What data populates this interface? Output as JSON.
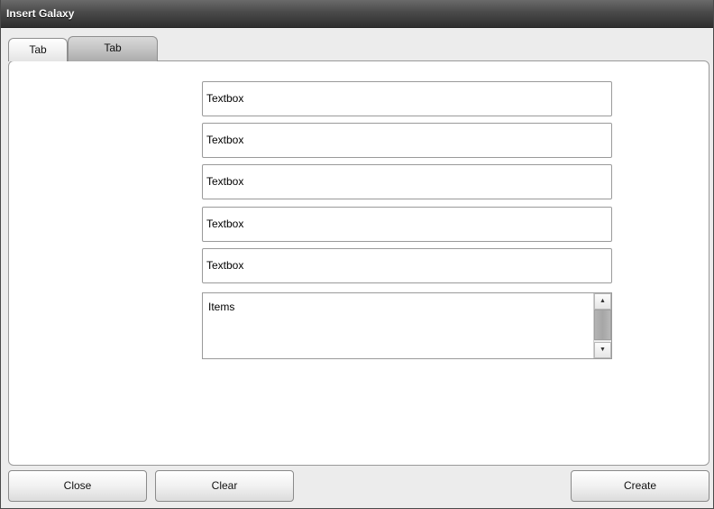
{
  "window": {
    "title": "Insert Galaxy"
  },
  "tabs": [
    {
      "label": "Tab"
    },
    {
      "label": "Tab"
    }
  ],
  "form": {
    "textboxes": [
      {
        "value": "Textbox"
      },
      {
        "value": "Textbox"
      },
      {
        "value": "Textbox"
      },
      {
        "value": "Textbox"
      },
      {
        "value": "Textbox"
      }
    ],
    "listbox": {
      "items": [
        "Items"
      ]
    }
  },
  "icons": {
    "scroll_up": "scroll-up-arrow-icon",
    "scroll_down": "scroll-down-arrow-icon"
  },
  "buttons": {
    "close_label": "Close",
    "clear_label": "Clear",
    "create_label": "Create"
  }
}
